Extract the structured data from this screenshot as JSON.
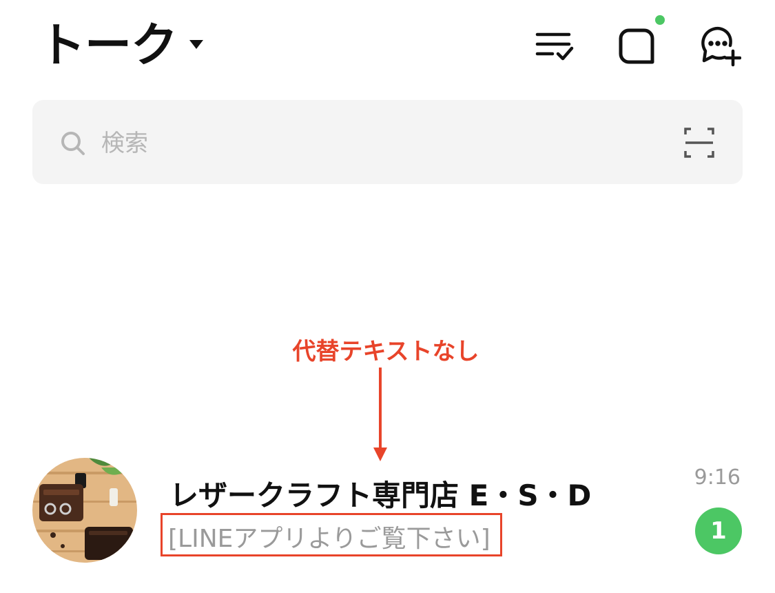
{
  "header": {
    "title": "トーク",
    "icons": [
      "sort-check-icon",
      "square-notification-icon",
      "new-chat-icon"
    ]
  },
  "search": {
    "placeholder": "検索",
    "icons": [
      "search-icon",
      "qr-scan-icon"
    ]
  },
  "annotation": {
    "label": "代替テキストなし",
    "color": "#e8442a"
  },
  "chats": [
    {
      "name": "レザークラフト専門店 E・S・D",
      "preview": "[LINEアプリよりご覧下さい]",
      "time": "9:16",
      "unread": "1"
    }
  ],
  "colors": {
    "accent_green": "#4cc764",
    "text_primary": "#111111",
    "text_secondary": "#9a9a9a",
    "search_bg": "#f4f4f4"
  }
}
